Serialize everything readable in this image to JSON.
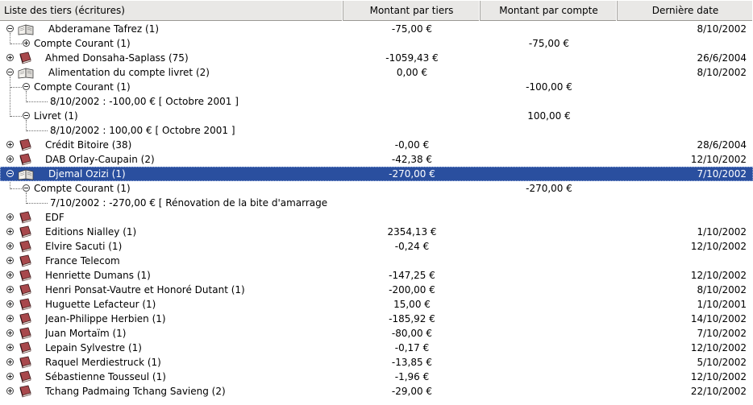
{
  "columns": {
    "name": "Liste des tiers (écritures)",
    "montant_tiers": "Montant par tiers",
    "montant_compte": "Montant par compte",
    "derniere_date": "Dernière date"
  },
  "rows": [
    {
      "label": "Abderamane Tafrez (1)",
      "amount": "-75,00 €",
      "date": "8/10/2002"
    },
    {
      "label": "Compte Courant (1)",
      "amount_compte": "-75,00 €"
    },
    {
      "label": "Ahmed Donsaha-Saplass (75)",
      "amount": "-1059,43 €",
      "date": "26/6/2004"
    },
    {
      "label": "Alimentation du compte livret (2)",
      "amount": "0,00 €",
      "date": "8/10/2002"
    },
    {
      "label": "Compte Courant (1)",
      "amount_compte": "-100,00 €"
    },
    {
      "label": "8/10/2002 : -100,00 € [ Octobre 2001 ]"
    },
    {
      "label": "Livret (1)",
      "amount_compte": "100,00 €"
    },
    {
      "label": "8/10/2002 : 100,00 € [ Octobre 2001 ]"
    },
    {
      "label": "Crédit Bitoire (38)",
      "amount": "-0,00 €",
      "date": "28/6/2004"
    },
    {
      "label": "DAB Orlay-Caupain (2)",
      "amount": "-42,38 €",
      "date": "12/10/2002"
    },
    {
      "label": "Djemal Ozizi (1)",
      "amount": "-270,00 €",
      "date": "7/10/2002"
    },
    {
      "label": "Compte Courant (1)",
      "amount_compte": "-270,00 €"
    },
    {
      "label": "7/10/2002 : -270,00 € [ Rénovation de la bite  d'amarrage"
    },
    {
      "label": "EDF"
    },
    {
      "label": "Editions Nialley (1)",
      "amount": "2354,13 €",
      "date": "1/10/2002"
    },
    {
      "label": "Elvire Sacuti (1)",
      "amount": "-0,24 €",
      "date": "12/10/2002"
    },
    {
      "label": "France Telecom"
    },
    {
      "label": "Henriette Dumans (1)",
      "amount": "-147,25 €",
      "date": "12/10/2002"
    },
    {
      "label": "Henri Ponsat-Vautre et Honoré Dutant (1)",
      "amount": "-200,00 €",
      "date": "8/10/2002"
    },
    {
      "label": "Huguette Lefacteur (1)",
      "amount": "15,00 €",
      "date": "1/10/2001"
    },
    {
      "label": "Jean-Philippe Herbien (1)",
      "amount": "-185,92 €",
      "date": "14/10/2002"
    },
    {
      "label": "Juan Mortaïm (1)",
      "amount": "-80,00 €",
      "date": "7/10/2002"
    },
    {
      "label": "Lepain Sylvestre (1)",
      "amount": "-0,17 €",
      "date": "12/10/2002"
    },
    {
      "label": "Raquel Merdiestruck (1)",
      "amount": "-13,85 €",
      "date": "5/10/2002"
    },
    {
      "label": "Sébastienne Tousseul (1)",
      "amount": "-1,96 €",
      "date": "12/10/2002"
    },
    {
      "label": "Tchang Padmaing Tchang Savieng (2)",
      "amount": "-29,00 €",
      "date": "22/10/2002"
    }
  ],
  "icons": {
    "closed_book": "closed-book-icon",
    "open_book": "open-book-icon"
  },
  "colors": {
    "selection": "#2a4f9f",
    "book_red": "#a8484c",
    "header_bg": "#e9e8e6"
  }
}
